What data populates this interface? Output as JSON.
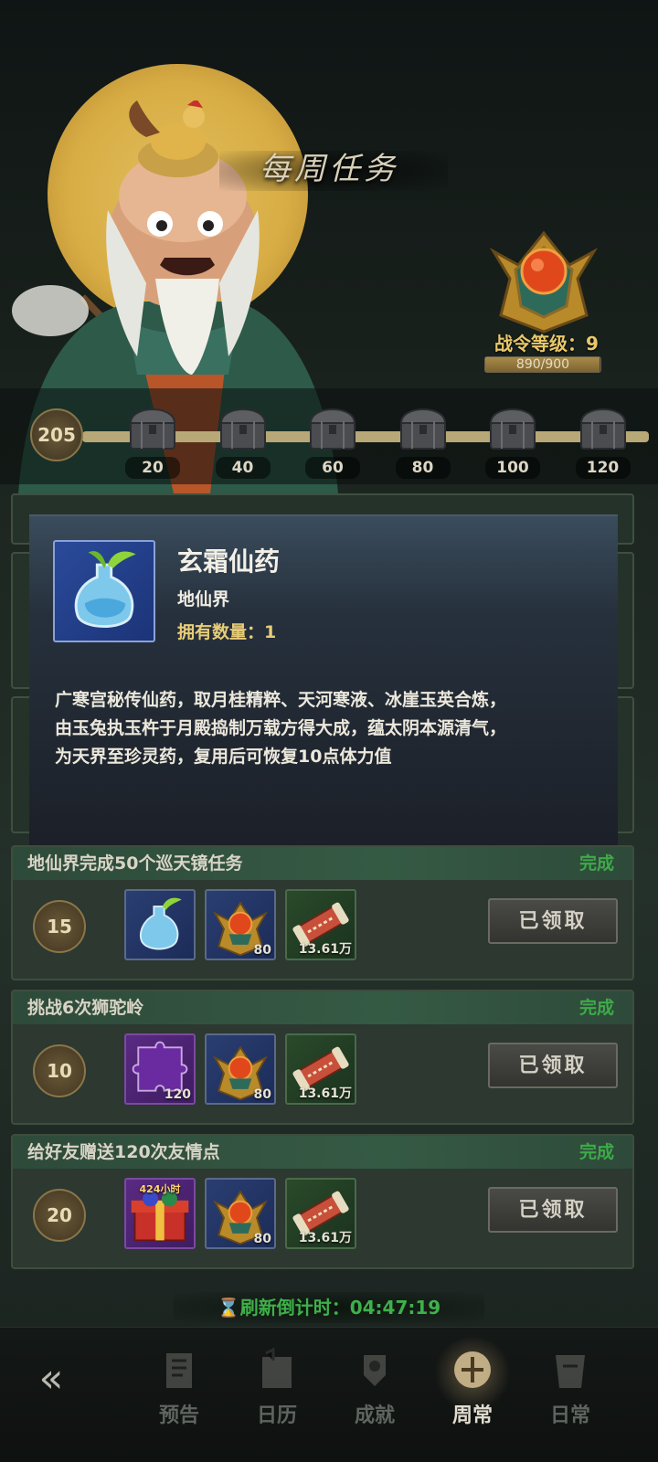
{
  "header": {
    "title": "每周任务",
    "battle_pass_level_label": "战令等级：9",
    "xp_text": "890/900",
    "xp_progress": 0.989
  },
  "track": {
    "current_points": "205",
    "milestones": [
      "20",
      "40",
      "60",
      "80",
      "100",
      "120"
    ]
  },
  "item_popup": {
    "name": "玄霜仙药",
    "realm": "地仙界",
    "owned": "拥有数量：1",
    "description_lines": [
      "广寒宫秘传仙药，取月桂精粹、天河寒液、冰崖玉英合炼，",
      "由玉兔执玉杵于月殿捣制万载方得大成，蕴太阴本源清气，",
      "为天界至珍灵药，复用后可恢复10点体力值"
    ]
  },
  "quests": [
    {
      "title": "地仙界完成50个巡天镜任务",
      "status": "完成",
      "points": "15",
      "rewards": [
        {
          "icon": "potion-icon",
          "count": ""
        },
        {
          "icon": "emblem-icon",
          "count": "80"
        },
        {
          "icon": "scroll-icon",
          "count": "13.61万"
        }
      ],
      "button": "已领取"
    },
    {
      "title": "挑战6次狮驼岭",
      "status": "完成",
      "points": "10",
      "rewards": [
        {
          "icon": "puzzle-icon",
          "count": "120"
        },
        {
          "icon": "emblem-icon",
          "count": "80"
        },
        {
          "icon": "scroll-icon",
          "count": "13.61万"
        }
      ],
      "button": "已领取"
    },
    {
      "title": "给好友赠送120次友情点",
      "status": "完成",
      "points": "20",
      "rewards": [
        {
          "icon": "gift-box-icon",
          "tag": "424小时",
          "count": ""
        },
        {
          "icon": "emblem-icon",
          "count": "80"
        },
        {
          "icon": "scroll-icon",
          "count": "13.61万"
        }
      ],
      "button": "已领取"
    }
  ],
  "refresh": "刷新倒计时：04:47:19",
  "nav": {
    "items": [
      "预告",
      "日历",
      "成就",
      "周常",
      "日常"
    ],
    "active": "周常"
  },
  "colors": {
    "status_green": "#3eaa48",
    "gold": "#e8c86a"
  }
}
